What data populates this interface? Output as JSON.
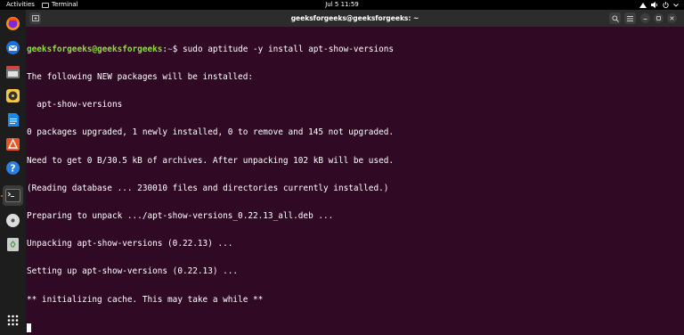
{
  "topbar": {
    "activities": "Activities",
    "app_name": "Terminal",
    "clock": "Jul 5  11:59",
    "tray_icons": [
      "network-icon",
      "volume-icon",
      "power-icon",
      "chevron-down-icon"
    ]
  },
  "dock": {
    "items": [
      {
        "name": "firefox-icon"
      },
      {
        "name": "thunderbird-icon"
      },
      {
        "name": "files-icon"
      },
      {
        "name": "rhythmbox-icon"
      },
      {
        "name": "writer-icon"
      },
      {
        "name": "software-icon"
      },
      {
        "name": "help-icon"
      },
      {
        "name": "terminal-icon",
        "active": true
      },
      {
        "name": "disc-icon"
      },
      {
        "name": "trash-icon"
      },
      {
        "name": "app-grid-icon"
      }
    ]
  },
  "window": {
    "title": "geeksforgeeks@geeksforgeeks: ~",
    "prompt_user": "geeksforgeeks@geeksforgeeks",
    "prompt_sep": ":",
    "prompt_path": "~",
    "prompt_symbol": "$ ",
    "command": "sudo aptitude -y install apt-show-versions",
    "output": [
      "The following NEW packages will be installed:",
      "  apt-show-versions",
      "0 packages upgraded, 1 newly installed, 0 to remove and 145 not upgraded.",
      "Need to get 0 B/30.5 kB of archives. After unpacking 102 kB will be used.",
      "(Reading database ... 230010 files and directories currently installed.)",
      "Preparing to unpack .../apt-show-versions_0.22.13_all.deb ...",
      "Unpacking apt-show-versions (0.22.13) ...",
      "Setting up apt-show-versions (0.22.13) ...",
      "** initializing cache. This may take a while **"
    ]
  },
  "colors": {
    "terminal_bg": "#300a24",
    "prompt_user": "#8ae234",
    "prompt_path": "#729fcf",
    "titlebar": "#2c2c2c",
    "dock": "#1d1d1d"
  }
}
